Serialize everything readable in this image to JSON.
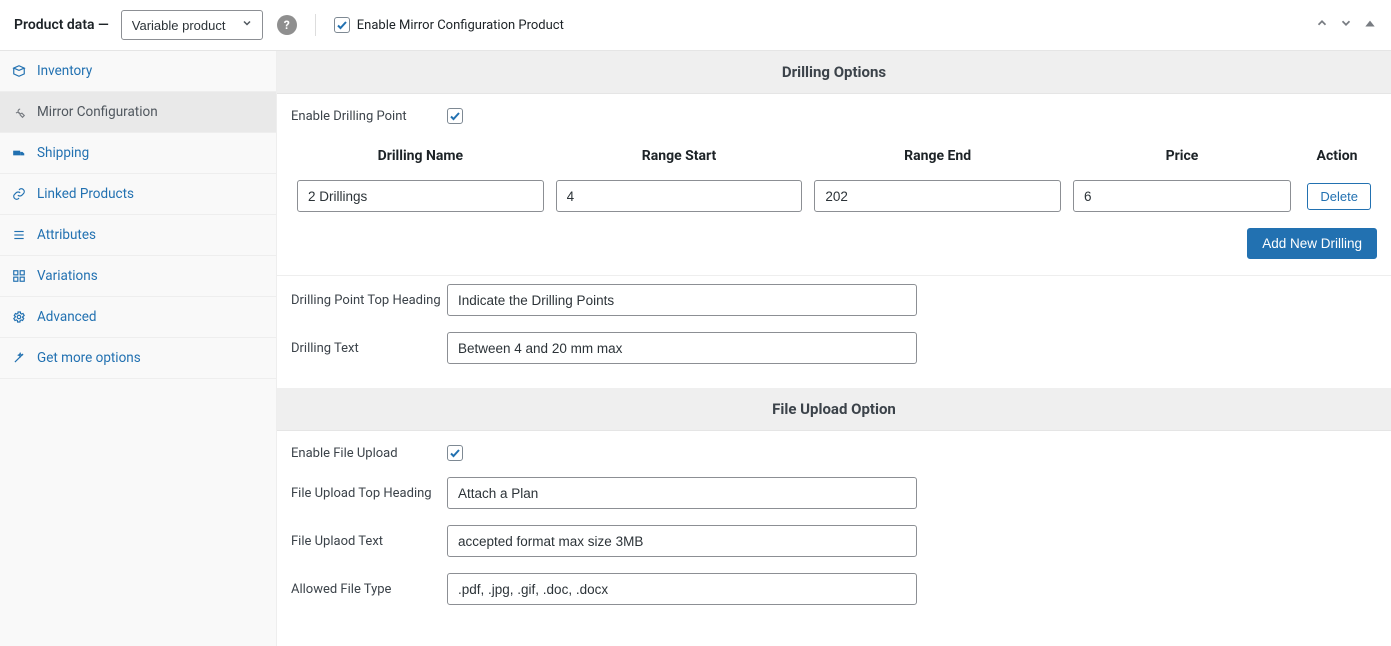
{
  "header": {
    "title": "Product data —",
    "product_type": "Variable product",
    "enable_mirror_label": "Enable Mirror Configuration Product"
  },
  "sidebar": {
    "items": [
      {
        "label": "Inventory"
      },
      {
        "label": "Mirror Configuration"
      },
      {
        "label": "Shipping"
      },
      {
        "label": "Linked Products"
      },
      {
        "label": "Attributes"
      },
      {
        "label": "Variations"
      },
      {
        "label": "Advanced"
      },
      {
        "label": "Get more options"
      }
    ]
  },
  "drilling": {
    "section_title": "Drilling Options",
    "enable_label": "Enable Drilling Point",
    "columns": {
      "name": "Drilling Name",
      "start": "Range Start",
      "end": "Range End",
      "price": "Price",
      "action": "Action"
    },
    "rows": [
      {
        "name": "2 Drillings",
        "start": "4",
        "end": "202",
        "price": "6"
      }
    ],
    "delete_label": "Delete",
    "add_label": "Add New Drilling",
    "top_heading_label": "Drilling Point Top Heading",
    "top_heading_value": "Indicate the Drilling Points",
    "text_label": "Drilling Text",
    "text_value": "Between 4 and 20 mm max"
  },
  "upload": {
    "section_title": "File Upload Option",
    "enable_label": "Enable File Upload",
    "heading_label": "File Upload Top Heading",
    "heading_value": "Attach a Plan",
    "text_label": "File Uplaod Text",
    "text_value": "accepted format max size 3MB",
    "types_label": "Allowed File Type",
    "types_value": ".pdf, .jpg, .gif, .doc, .docx"
  }
}
